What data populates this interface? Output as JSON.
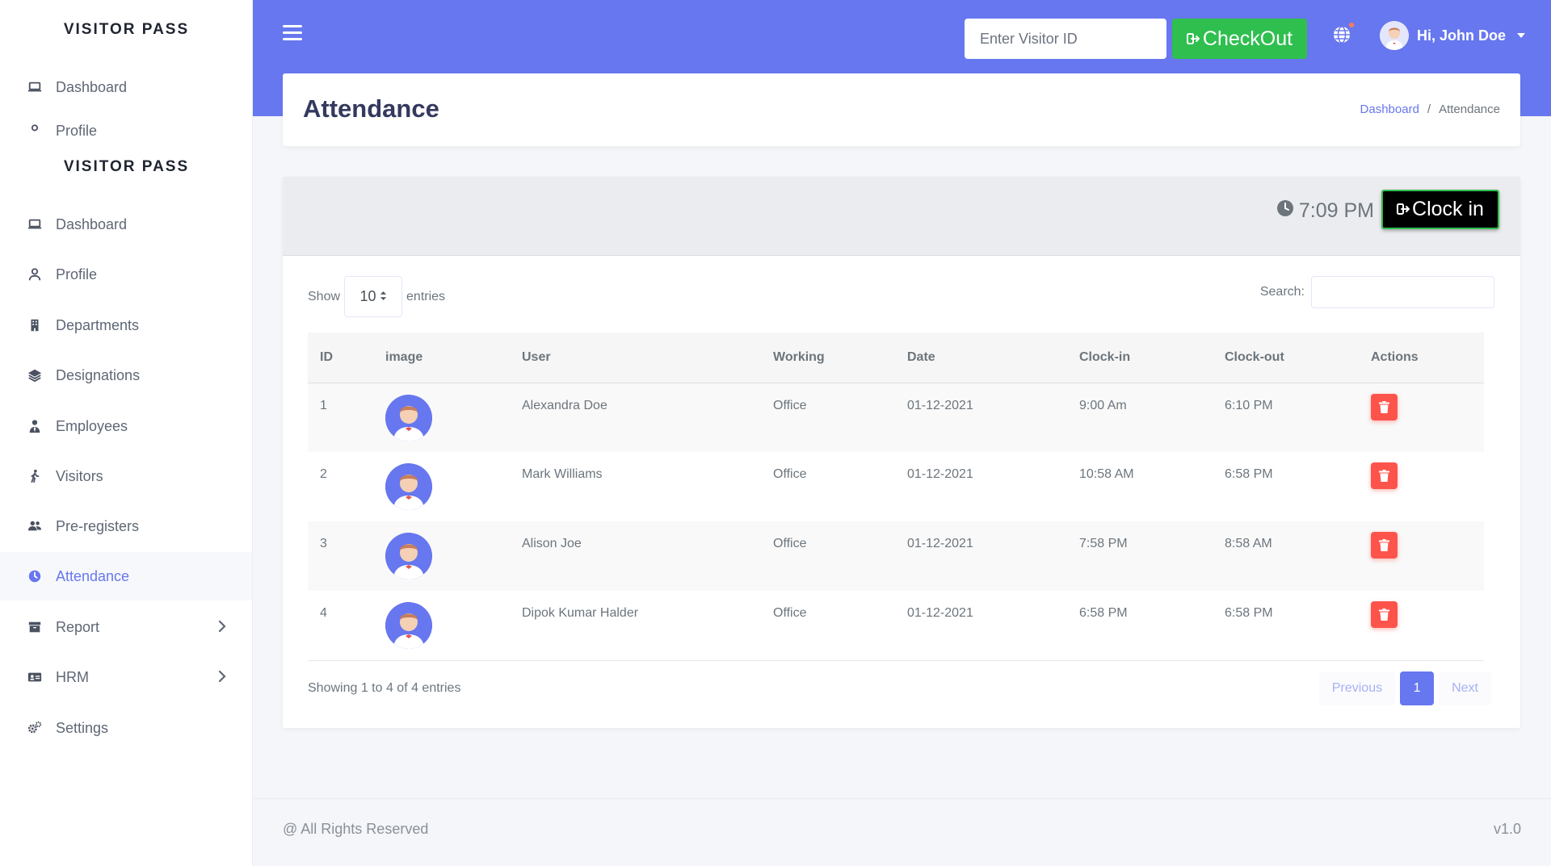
{
  "brand": "VISITOR PASS",
  "ghost_nav": [
    "Dashboard",
    "Profile"
  ],
  "sidebar": {
    "items": [
      {
        "label": "Dashboard",
        "icon": "laptop-icon"
      },
      {
        "label": "Profile",
        "icon": "user-icon"
      },
      {
        "label": "Departments",
        "icon": "building-icon"
      },
      {
        "label": "Designations",
        "icon": "layers-icon"
      },
      {
        "label": "Employees",
        "icon": "user-tie-icon"
      },
      {
        "label": "Visitors",
        "icon": "walking-icon"
      },
      {
        "label": "Pre-registers",
        "icon": "users-icon"
      },
      {
        "label": "Attendance",
        "icon": "clock-icon",
        "active": true
      },
      {
        "label": "Report",
        "icon": "archive-icon",
        "submenu": true
      },
      {
        "label": "HRM",
        "icon": "id-card-icon",
        "submenu": true
      },
      {
        "label": "Settings",
        "icon": "cogs-icon"
      }
    ]
  },
  "topbar": {
    "visitor_placeholder": "Enter Visitor ID",
    "checkout_label": "CheckOut",
    "user_greeting": "Hi, John Doe"
  },
  "page": {
    "title": "Attendance",
    "breadcrumb": [
      "Dashboard",
      "/",
      "Attendance"
    ]
  },
  "clock": {
    "time": "7:09 PM",
    "clock_in_label": "Clock in"
  },
  "table": {
    "show_label": "Show",
    "entries_value": "10",
    "entries_label": "entries",
    "search_label": "Search:",
    "columns": [
      "ID",
      "image",
      "User",
      "Working",
      "Date",
      "Clock-in",
      "Clock-out",
      "Actions"
    ],
    "rows": [
      {
        "id": "1",
        "user": "Alexandra Doe",
        "working": "Office",
        "date": "01-12-2021",
        "clock_in": "9:00 Am",
        "clock_out": "6:10 PM"
      },
      {
        "id": "2",
        "user": "Mark Williams",
        "working": "Office",
        "date": "01-12-2021",
        "clock_in": "10:58 AM",
        "clock_out": "6:58 PM"
      },
      {
        "id": "3",
        "user": "Alison Joe",
        "working": "Office",
        "date": "01-12-2021",
        "clock_in": "7:58 PM",
        "clock_out": "8:58 AM"
      },
      {
        "id": "4",
        "user": "Dipok Kumar Halder",
        "working": "Office",
        "date": "01-12-2021",
        "clock_in": "6:58 PM",
        "clock_out": "6:58 PM"
      }
    ],
    "info": "Showing 1 to 4 of 4 entries",
    "pagination": {
      "previous": "Previous",
      "current": "1",
      "next": "Next"
    }
  },
  "footer": {
    "left": "@ All Rights Reserved",
    "right": "v1.0"
  },
  "colors": {
    "accent": "#6777ef",
    "checkout": "#2fbf4f",
    "danger": "#fc544b"
  }
}
